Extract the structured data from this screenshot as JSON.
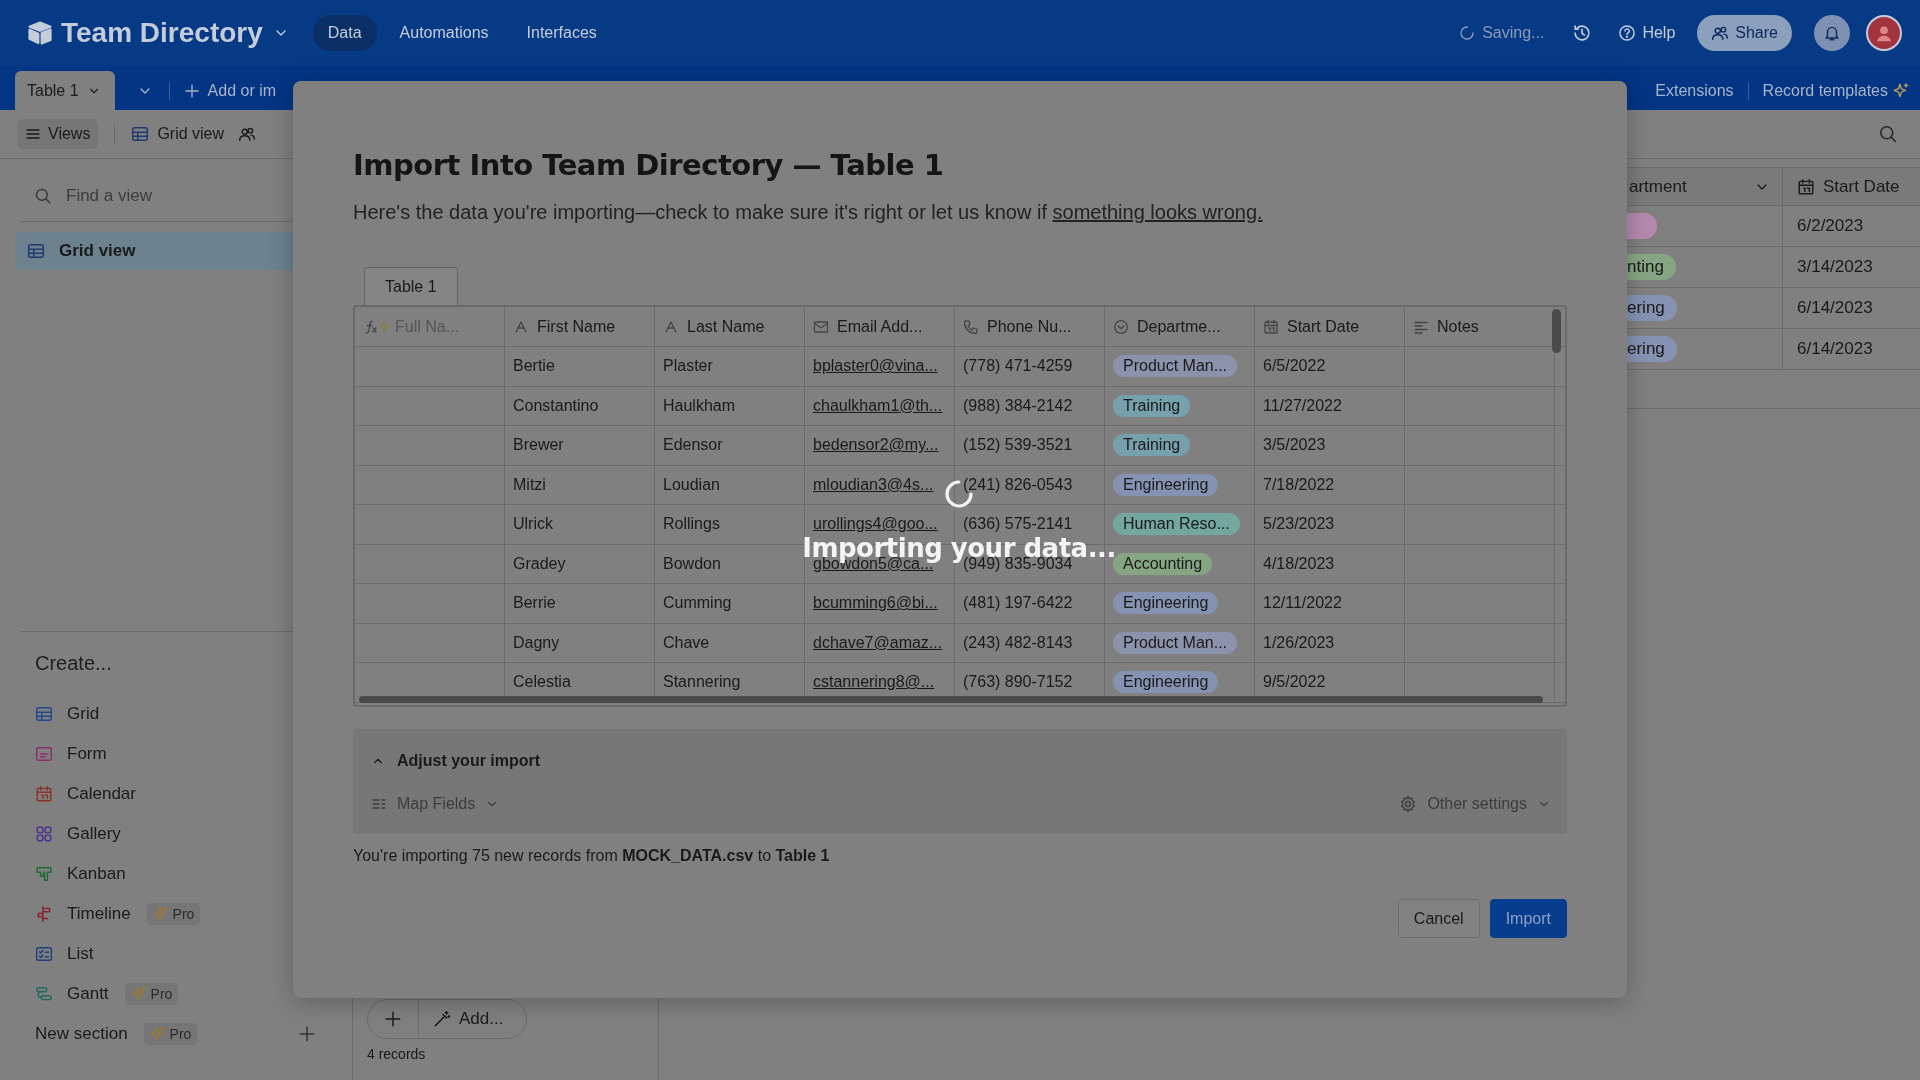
{
  "app_header": {
    "base_name": "Team Directory",
    "nav": [
      {
        "label": "Data",
        "selected": true
      },
      {
        "label": "Automations",
        "selected": false
      },
      {
        "label": "Interfaces",
        "selected": false
      }
    ],
    "status": "Saving...",
    "help": "Help",
    "share": "Share"
  },
  "table_bar": {
    "tabs": [
      {
        "label": "Table 1",
        "selected": true
      }
    ],
    "add_label": "Add or im",
    "extensions": "Extensions",
    "record_templates": "Record templates"
  },
  "view_bar": {
    "views_button": "Views",
    "current_view": "Grid view"
  },
  "sidebar": {
    "search_placeholder": "Find a view",
    "views": [
      {
        "label": "Grid view",
        "selected": true
      }
    ],
    "create_heading": "Create...",
    "create_items": [
      {
        "kind": "grid",
        "label": "Grid"
      },
      {
        "kind": "form",
        "label": "Form"
      },
      {
        "kind": "calendar",
        "label": "Calendar"
      },
      {
        "kind": "gallery",
        "label": "Gallery"
      },
      {
        "kind": "kanban",
        "label": "Kanban"
      },
      {
        "kind": "timeline",
        "label": "Timeline",
        "badge": "Pro"
      },
      {
        "kind": "list",
        "label": "List"
      },
      {
        "kind": "gantt",
        "label": "Gantt",
        "badge": "Pro"
      }
    ],
    "new_section": {
      "label": "New section",
      "badge": "Pro"
    }
  },
  "background_grid": {
    "columns": [
      "artment",
      "Start Date"
    ],
    "rows": [
      {
        "color": "#b58aae",
        "start_date": "6/2/2023"
      },
      {
        "department": "nting",
        "color": "#86a683",
        "start_date": "3/14/2023"
      },
      {
        "department": "ering",
        "color": "#8692b2",
        "start_date": "6/14/2023"
      },
      {
        "department": "ering",
        "color": "#8692b2",
        "start_date": "6/14/2023"
      }
    ],
    "add_button": "Add...",
    "record_count": "4 records"
  },
  "import_dialog": {
    "title": "Import Into Team Directory — Table 1",
    "description": "Here's the data you're importing—check to make sure it's right or let us know if",
    "link": "something looks wrong.",
    "sheet_tabs": [
      {
        "label": "Table 1",
        "selected": true
      }
    ],
    "columns": [
      {
        "kind": "formula",
        "label": "Full Na..."
      },
      {
        "kind": "text",
        "label": "First Name"
      },
      {
        "kind": "text",
        "label": "Last Name"
      },
      {
        "kind": "email",
        "label": "Email Add..."
      },
      {
        "kind": "phone",
        "label": "Phone Nu..."
      },
      {
        "kind": "select",
        "label": "Departme..."
      },
      {
        "kind": "date",
        "label": "Start Date"
      },
      {
        "kind": "notes",
        "label": "Notes"
      }
    ],
    "rows": [
      {
        "first_name": "Bertie",
        "last_name": "Plaster",
        "email": "bplaster0@vina...",
        "phone": "(778) 471-4259",
        "department": "Product Man...",
        "color": "#8a93ab",
        "start_date": "6/5/2022"
      },
      {
        "first_name": "Constantino",
        "last_name": "Haulkham",
        "email": "chaulkham1@th...",
        "phone": "(988) 384-2142",
        "department": "Training",
        "color": "#77a0ad",
        "start_date": "11/27/2022"
      },
      {
        "first_name": "Brewer",
        "last_name": "Edensor",
        "email": "bedensor2@my...",
        "phone": "(152) 539-3521",
        "department": "Training",
        "color": "#77a0ad",
        "start_date": "3/5/2023"
      },
      {
        "first_name": "Mitzi",
        "last_name": "Loudian",
        "email": "mloudian3@4s...",
        "phone": "(241) 826-0543",
        "department": "Engineering",
        "color": "#8692b2",
        "start_date": "7/18/2022"
      },
      {
        "first_name": "Ulrick",
        "last_name": "Rollings",
        "email": "urollings4@goo...",
        "phone": "(636) 575-2141",
        "department": "Human Reso...",
        "color": "#73a7a0",
        "start_date": "5/23/2023"
      },
      {
        "first_name": "Gradey",
        "last_name": "Bowdon",
        "email": "gbowdon5@ca...",
        "phone": "(949) 835-9034",
        "department": "Accounting",
        "color": "#86a683",
        "start_date": "4/18/2023"
      },
      {
        "first_name": "Berrie",
        "last_name": "Cumming",
        "email": "bcumming6@bi...",
        "phone": "(481) 197-6422",
        "department": "Engineering",
        "color": "#8692b2",
        "start_date": "12/11/2022"
      },
      {
        "first_name": "Dagny",
        "last_name": "Chave",
        "email": "dchave7@amaz...",
        "phone": "(243) 482-8143",
        "department": "Product Man...",
        "color": "#8a93ab",
        "start_date": "1/26/2023"
      },
      {
        "first_name": "Celestia",
        "last_name": "Stannering",
        "email": "cstannering8@...",
        "phone": "(763) 890-7152",
        "department": "Engineering",
        "color": "#8692b2",
        "start_date": "9/5/2022"
      }
    ],
    "adjust": {
      "title": "Adjust your import",
      "expanded": true,
      "map_fields": "Map Fields",
      "other_settings": "Other settings"
    },
    "summary": "You're importing 75 new records from **MOCK_DATA.csv** to **Table 1**",
    "buttons": [
      {
        "kind": "secondary",
        "label": "Cancel"
      },
      {
        "kind": "primary",
        "label": "Import"
      }
    ]
  },
  "loading": {
    "message": "Importing your data..."
  }
}
